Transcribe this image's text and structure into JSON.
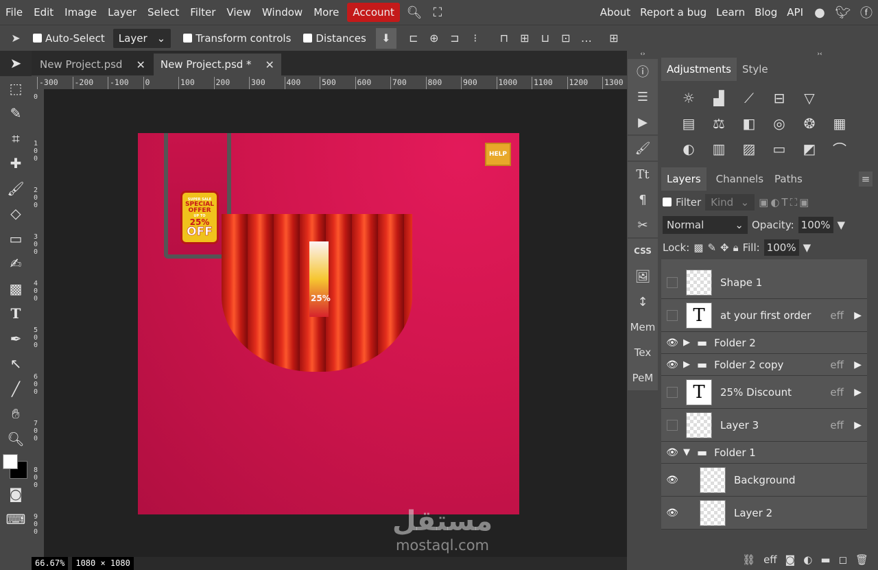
{
  "menu": {
    "items": [
      "File",
      "Edit",
      "Image",
      "Layer",
      "Select",
      "Filter",
      "View",
      "Window",
      "More"
    ],
    "account": "Account",
    "right": [
      "About",
      "Report a bug",
      "Learn",
      "Blog",
      "API"
    ]
  },
  "options": {
    "auto_select": "Auto-Select",
    "layer_mode": "Layer",
    "transform_controls": "Transform controls",
    "distances": "Distances"
  },
  "tabs": [
    {
      "label": "New Project.psd",
      "active": false
    },
    {
      "label": "New Project.psd *",
      "active": true
    }
  ],
  "ruler": {
    "top": [
      "-300",
      "-200",
      "-100",
      "0",
      "100",
      "200",
      "300",
      "400",
      "500",
      "600",
      "700",
      "800",
      "900",
      "1000",
      "1100",
      "1200",
      "1300"
    ],
    "left": [
      "0",
      "100",
      "200",
      "300",
      "400",
      "500",
      "600",
      "700",
      "800",
      "900"
    ]
  },
  "canvas": {
    "tag_small": "SUPER SALE",
    "tag_offer": "SPECIAL OFFER",
    "tag_upto": "UP TO",
    "tag_pct": "25%",
    "tag_off": "OFF",
    "help_sign": "HELP",
    "curtain_pct": "25%"
  },
  "watermark": {
    "arabic": "مستقل",
    "latin": "mostaql.com"
  },
  "status": {
    "zoom": "66.67%",
    "size": "1080 × 1080"
  },
  "iconcol": {
    "mem": "Mem",
    "tex": "Tex",
    "pem": "PeM",
    "css": "CSS"
  },
  "panel": {
    "top_tabs": [
      "Adjustments",
      "Style"
    ],
    "layer_tabs": [
      "Layers",
      "Channels",
      "Paths"
    ],
    "filter_label": "Filter",
    "kind_label": "Kind",
    "blend_mode": "Normal",
    "opacity_label": "Opacity:",
    "opacity_value": "100%",
    "lock_label": "Lock:",
    "fill_label": "Fill:",
    "fill_value": "100%"
  },
  "layers": [
    {
      "name": "Shape 1",
      "type": "shape",
      "visible": false,
      "eff": false
    },
    {
      "name": "at your first order",
      "type": "text",
      "visible": false,
      "eff": true
    },
    {
      "name": "Folder 2",
      "type": "folder",
      "visible": true,
      "eff": false
    },
    {
      "name": "Folder 2 copy",
      "type": "folder",
      "visible": true,
      "eff": true
    },
    {
      "name": "25% Discount",
      "type": "text",
      "visible": false,
      "eff": true
    },
    {
      "name": "Layer 3",
      "type": "shape",
      "visible": false,
      "eff": true
    },
    {
      "name": "Folder 1",
      "type": "folder-open",
      "visible": true,
      "eff": false
    },
    {
      "name": "Background",
      "type": "image",
      "visible": true,
      "eff": false
    },
    {
      "name": "Layer 2",
      "type": "image",
      "visible": true,
      "eff": false
    }
  ],
  "eff_label": "eff",
  "colors": {
    "accent": "#c41a1a",
    "canvas": "#d0154d"
  }
}
